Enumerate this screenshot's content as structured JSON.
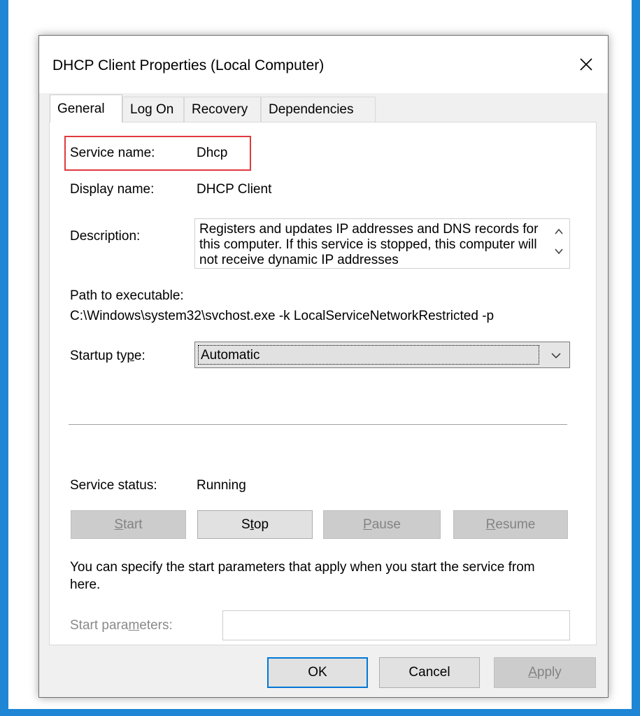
{
  "window": {
    "title": "DHCP Client Properties (Local Computer)"
  },
  "tabs": [
    {
      "label": "General"
    },
    {
      "label": "Log On"
    },
    {
      "label": "Recovery"
    },
    {
      "label": "Dependencies"
    }
  ],
  "general": {
    "service_name_label": "Service name:",
    "service_name_value": "Dhcp",
    "display_name_label": "Display name:",
    "display_name_value": "DHCP Client",
    "description_label": "Description:",
    "description_value": "Registers and updates IP addresses and DNS records for this computer. If this service is stopped, this computer will not receive dynamic IP addresses",
    "path_label": "Path to executable:",
    "path_value": "C:\\Windows\\system32\\svchost.exe -k LocalServiceNetworkRestricted -p",
    "startup_type_label": "Startup type:",
    "startup_type_value": "Automatic",
    "service_status_label": "Service status:",
    "service_status_value": "Running",
    "start_label": "Start",
    "stop_label": "Stop",
    "pause_label": "Pause",
    "resume_label": "Resume",
    "hint_text": "You can specify the start parameters that apply when you start the service from here.",
    "start_params_label": "Start parameters:",
    "start_params_value": ""
  },
  "footer": {
    "ok_label": "OK",
    "cancel_label": "Cancel",
    "apply_label": "Apply"
  },
  "colors": {
    "highlight_border": "#e0393e",
    "focus_border": "#0078d7",
    "desktop_blue": "#1f86d6"
  }
}
